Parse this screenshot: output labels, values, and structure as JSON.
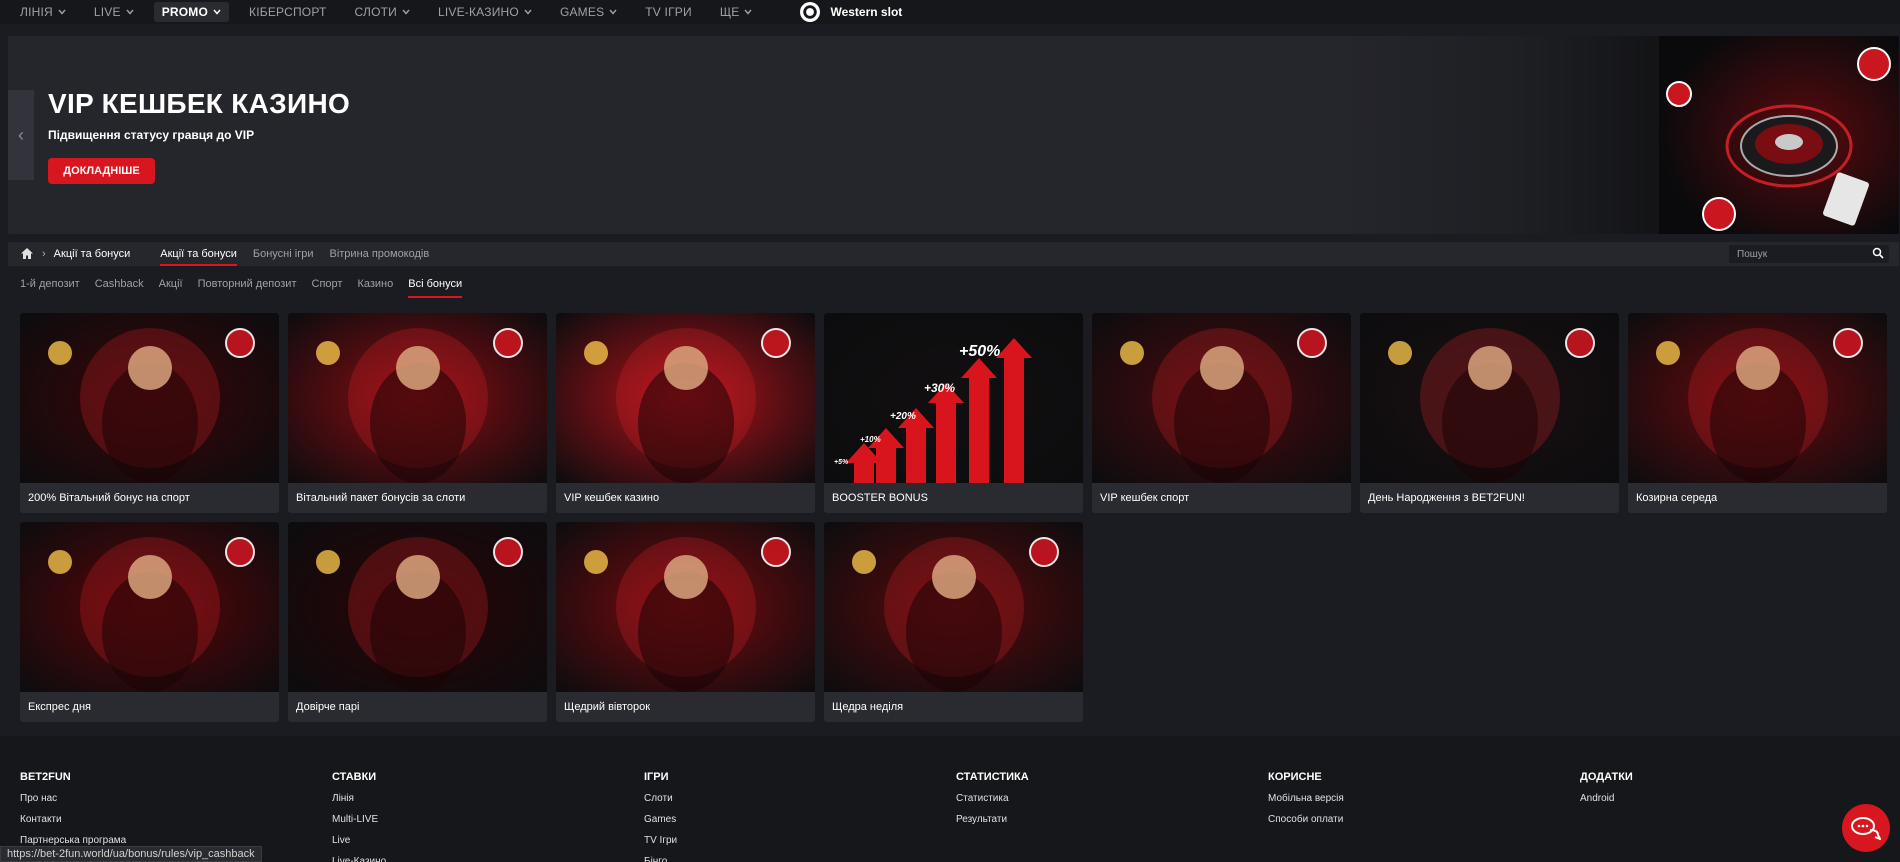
{
  "nav": {
    "items": [
      {
        "label": "Лінія",
        "chevron": true
      },
      {
        "label": "Live",
        "chevron": true
      },
      {
        "label": "Promo",
        "chevron": true,
        "active": true
      },
      {
        "label": "Кіберспорт",
        "chevron": false
      },
      {
        "label": "Слоти",
        "chevron": true
      },
      {
        "label": "Live-казино",
        "chevron": true
      },
      {
        "label": "Games",
        "chevron": true
      },
      {
        "label": "TV Ігри",
        "chevron": false
      },
      {
        "label": "Ще",
        "chevron": true
      }
    ],
    "logo_label": "Western slot"
  },
  "banner": {
    "title": "VIP КЕШБЕК КАЗИНО",
    "subtitle": "Підвищення статусу гравця до VIP",
    "button_label": "ДОКЛАДНІШЕ",
    "prev_icon": "chevron-left-icon"
  },
  "breadcrumb": {
    "home_icon": "home-icon",
    "current": "Акції та бонуси",
    "tabs": [
      "Акції та бонуси",
      "Бонусні ігри",
      "Вітрина промокодів"
    ],
    "active_tab": 0,
    "search_placeholder": "Пошук"
  },
  "filters": {
    "items": [
      "1-й депозит",
      "Cashback",
      "Акції",
      "Повторний депозит",
      "Спорт",
      "Казино",
      "Всі бонуси"
    ],
    "active": 6
  },
  "cards": [
    {
      "title": "200% Вітальний бонус на спорт",
      "theme": "sport"
    },
    {
      "title": "Вітальний пакет бонусів за слоти",
      "theme": "slots"
    },
    {
      "title": "VIP кешбек казино",
      "theme": "roulette"
    },
    {
      "title": "BOOSTER BONUS",
      "theme": "booster"
    },
    {
      "title": "VIP кешбек спорт",
      "theme": "vip"
    },
    {
      "title": "День Народження з BET2FUN!",
      "theme": "birthday"
    },
    {
      "title": "Козирна середа",
      "theme": "queen"
    },
    {
      "title": "Експрес дня",
      "theme": "express"
    },
    {
      "title": "Довірче парі",
      "theme": "safe"
    },
    {
      "title": "Щедрий вівторок",
      "theme": "queen2"
    },
    {
      "title": "Щедра неділя",
      "theme": "lucky"
    }
  ],
  "booster_labels": [
    "+50%",
    "+30%",
    "+20%",
    "+10%",
    "+5%"
  ],
  "footer": {
    "columns": [
      {
        "title": "BET2FUN",
        "links": [
          "Про нас",
          "Контакти",
          "Партнерська програма"
        ]
      },
      {
        "title": "Ставки",
        "links": [
          "Лінія",
          "Multi-LIVE",
          "Live",
          "Live-Казино"
        ]
      },
      {
        "title": "Ігри",
        "links": [
          "Слоти",
          "Games",
          "TV Ігри",
          "Бінго"
        ]
      },
      {
        "title": "Статистика",
        "links": [
          "Статистика",
          "Результати"
        ]
      },
      {
        "title": "Корисне",
        "links": [
          "Мобільна версія",
          "Способи оплати"
        ]
      },
      {
        "title": "Додатки",
        "links": [
          "Android"
        ]
      }
    ]
  },
  "status_url": "https://bet-2fun.world/ua/bonus/rules/vip_cashback",
  "colors": {
    "accent": "#d7161f",
    "bg": "#1b1c21",
    "panel": "#26272d",
    "card": "#2a2b31"
  },
  "chat_icon": "chat-bubbles-icon"
}
